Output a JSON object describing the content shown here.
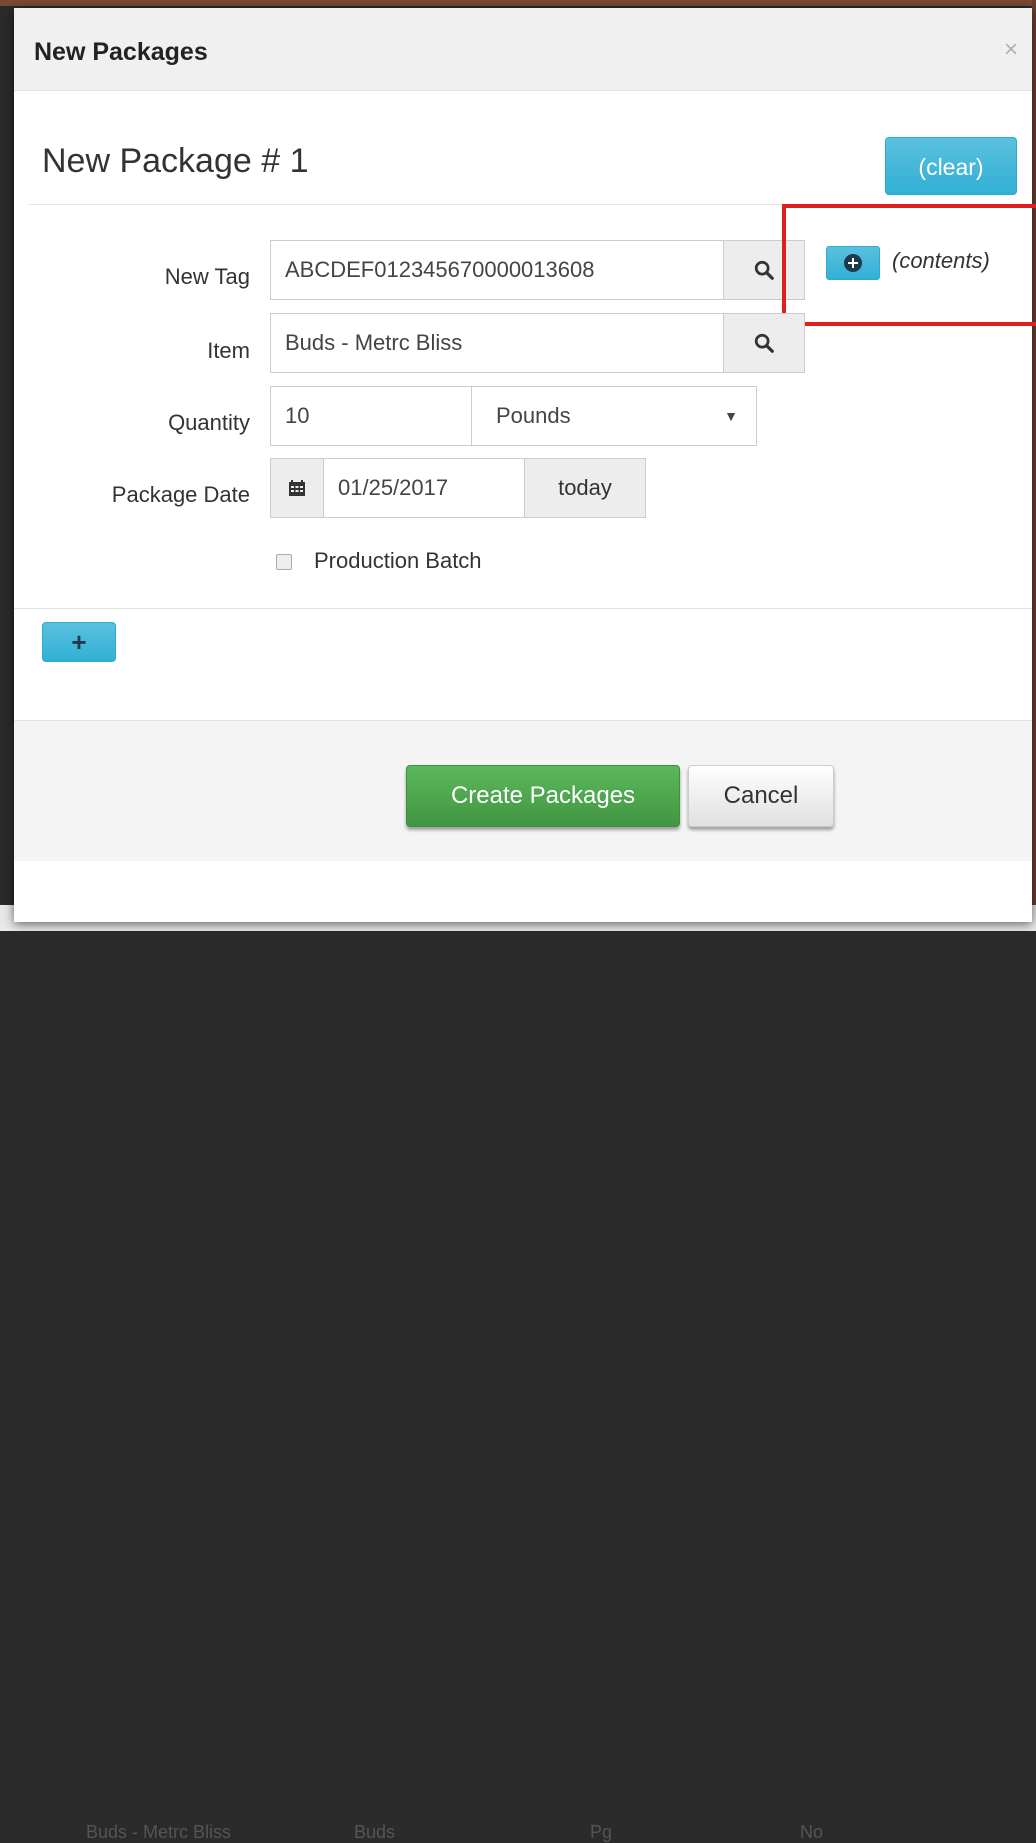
{
  "background": {
    "row_cells": [
      "Buds - Metrc Bliss",
      "Buds",
      "Pg",
      "No"
    ]
  },
  "modal": {
    "title": "New Packages",
    "close_symbol": "×"
  },
  "package": {
    "heading": "New Package # 1",
    "clear_label": "(clear)",
    "contents_label": "(contents)"
  },
  "form": {
    "new_tag_label": "New Tag",
    "new_tag_value": "ABCDEF012345670000013608",
    "item_label": "Item",
    "item_value": "Buds - Metrc Bliss",
    "quantity_label": "Quantity",
    "quantity_value": "10",
    "unit_value": "Pounds",
    "package_date_label": "Package Date",
    "package_date_value": "01/25/2017",
    "today_label": "today",
    "production_batch_label": "Production Batch",
    "production_batch_checked": false
  },
  "footer": {
    "create_label": "Create Packages",
    "cancel_label": "Cancel"
  },
  "colors": {
    "info": "#31b0d5",
    "success": "#419641",
    "highlight": "#e0201c"
  },
  "icons": {
    "search": "search-icon",
    "calendar": "calendar-icon",
    "add_contents": "plus-circle-icon",
    "add_package": "plus-icon",
    "dropdown": "caret-down-icon"
  }
}
